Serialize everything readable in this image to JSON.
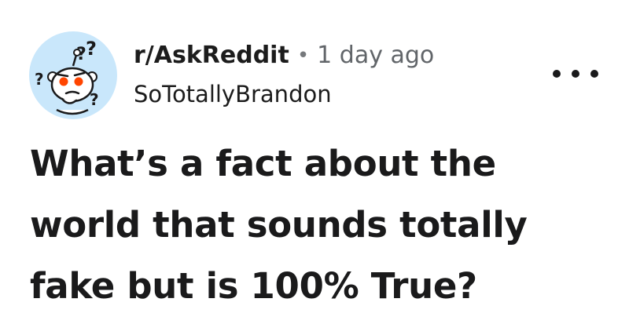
{
  "post": {
    "subreddit": "r/AskReddit",
    "separator": "•",
    "time_ago": "1 day ago",
    "author": "SoTotallyBrandon",
    "title": "What’s a fact about the world that sounds totally fake but is 100% True?",
    "avatar_icon": "confused-snoo-avatar-icon",
    "more_icon": "more-options-icon"
  },
  "colors": {
    "avatar_bg": "#c9e7fb",
    "text_primary": "#1a1a1b",
    "text_secondary": "#616569",
    "snoo_eye": "#ff4500"
  }
}
